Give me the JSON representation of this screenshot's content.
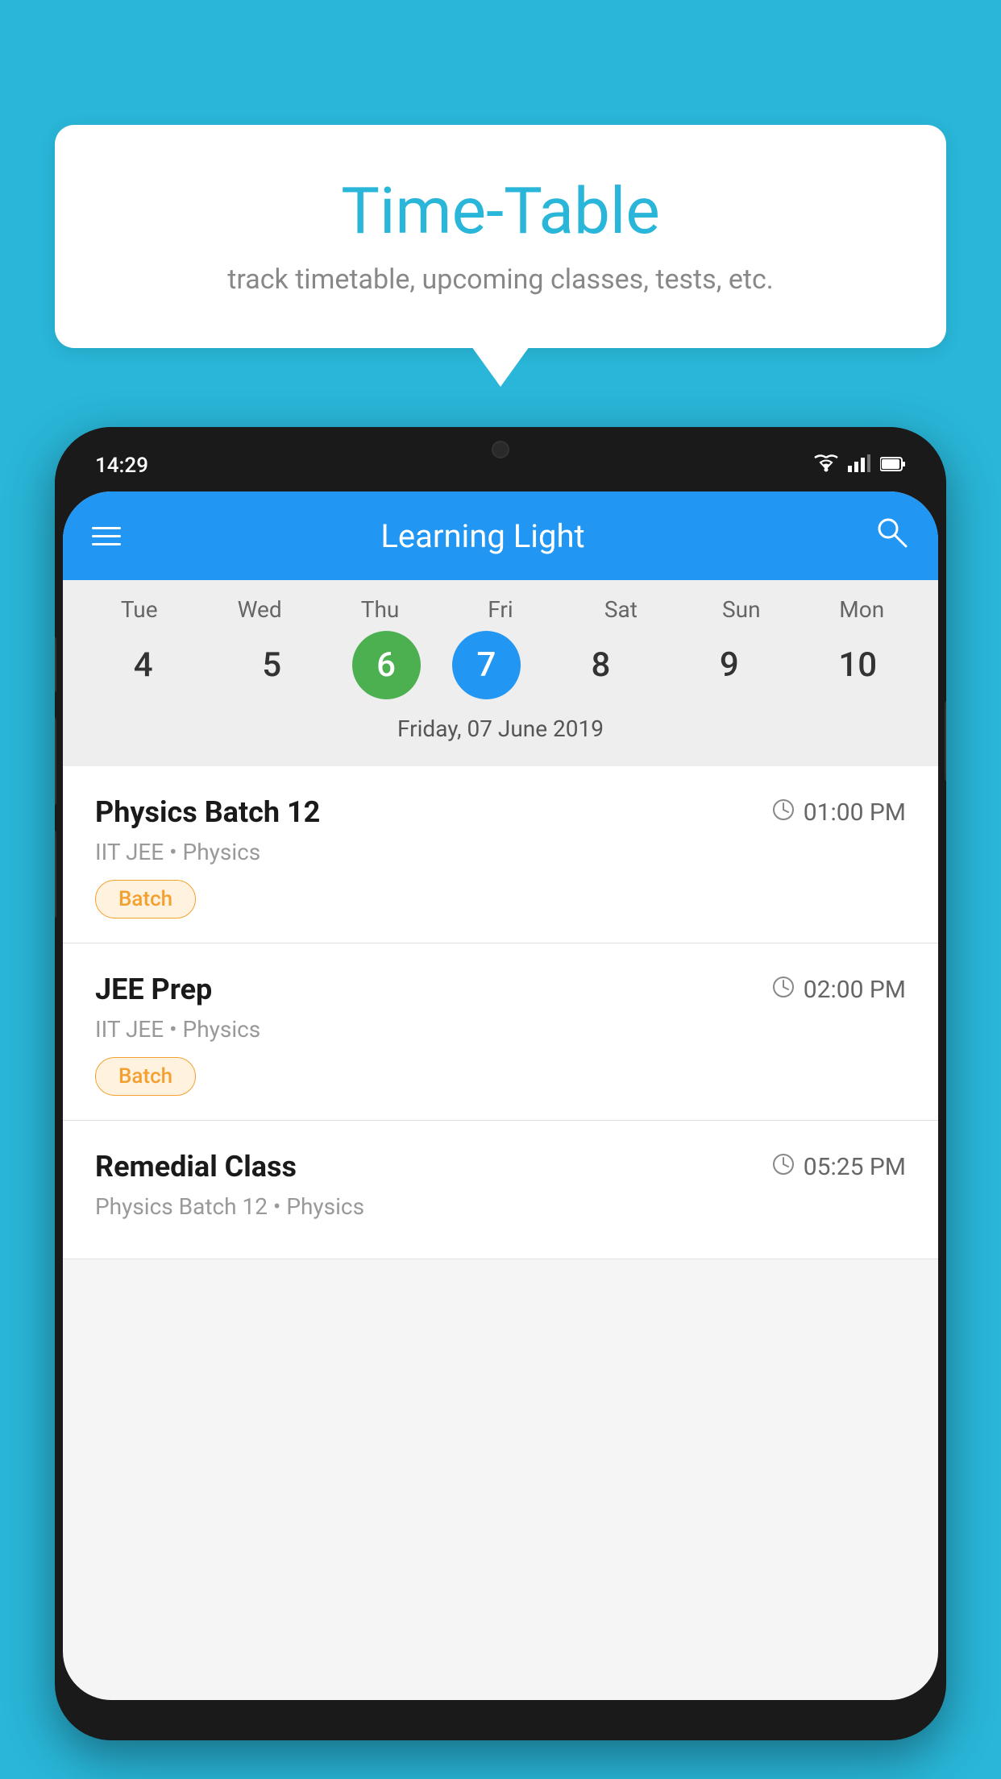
{
  "background_color": "#29b6d8",
  "speech_bubble": {
    "title": "Time-Table",
    "subtitle": "track timetable, upcoming classes, tests, etc."
  },
  "status_bar": {
    "time": "14:29",
    "wifi": "▼",
    "signal": "▲",
    "battery": "▮"
  },
  "app_header": {
    "title": "Learning Light",
    "menu_icon": "hamburger",
    "search_icon": "search"
  },
  "calendar": {
    "selected_date_label": "Friday, 07 June 2019",
    "days": [
      {
        "label": "Tue",
        "number": "4",
        "state": "normal"
      },
      {
        "label": "Wed",
        "number": "5",
        "state": "normal"
      },
      {
        "label": "Thu",
        "number": "6",
        "state": "today"
      },
      {
        "label": "Fri",
        "number": "7",
        "state": "selected"
      },
      {
        "label": "Sat",
        "number": "8",
        "state": "normal"
      },
      {
        "label": "Sun",
        "number": "9",
        "state": "normal"
      },
      {
        "label": "Mon",
        "number": "10",
        "state": "normal"
      }
    ]
  },
  "schedule_items": [
    {
      "title": "Physics Batch 12",
      "time": "01:00 PM",
      "meta": "IIT JEE • Physics",
      "tag": "Batch"
    },
    {
      "title": "JEE Prep",
      "time": "02:00 PM",
      "meta": "IIT JEE • Physics",
      "tag": "Batch"
    },
    {
      "title": "Remedial Class",
      "time": "05:25 PM",
      "meta": "Physics Batch 12 • Physics",
      "tag": null
    }
  ]
}
